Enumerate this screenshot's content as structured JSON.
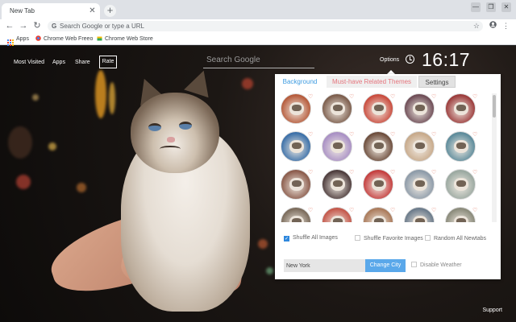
{
  "browser": {
    "tab_title": "New Tab",
    "tab_close_icon": "close-icon",
    "new_tab_symbol": "+",
    "window_controls": [
      "—",
      "❐",
      "✕"
    ],
    "omnibox_placeholder": "Search Google or type a URL",
    "bookmarks": [
      {
        "label": "Apps",
        "icon": "apps-grid-icon"
      },
      {
        "label": "Chrome Web Freeo",
        "icon": "chrome-web-store-icon"
      },
      {
        "label": "Chrome Web Store",
        "icon": "chrome-web-store-icon"
      }
    ]
  },
  "page": {
    "nav": [
      "Most Visited",
      "Apps",
      "Share"
    ],
    "rate_label": "Rate",
    "search_placeholder": "Search Google",
    "options_label": "Options",
    "time": "16:17",
    "support_label": "Support"
  },
  "panel": {
    "tabs": [
      "Background",
      "Must-have Related Themes",
      "Settings"
    ],
    "shuffle_all": "Shuffle All Images",
    "shuffle_favorite": "Shuffle Favorite Images",
    "random_all": "Random All Newtabs",
    "city_value": "New York",
    "change_city": "Change City",
    "disable_weather": "Disable Weather",
    "accent_color": "#5aa8ea",
    "heart_color": "#e0705a"
  }
}
